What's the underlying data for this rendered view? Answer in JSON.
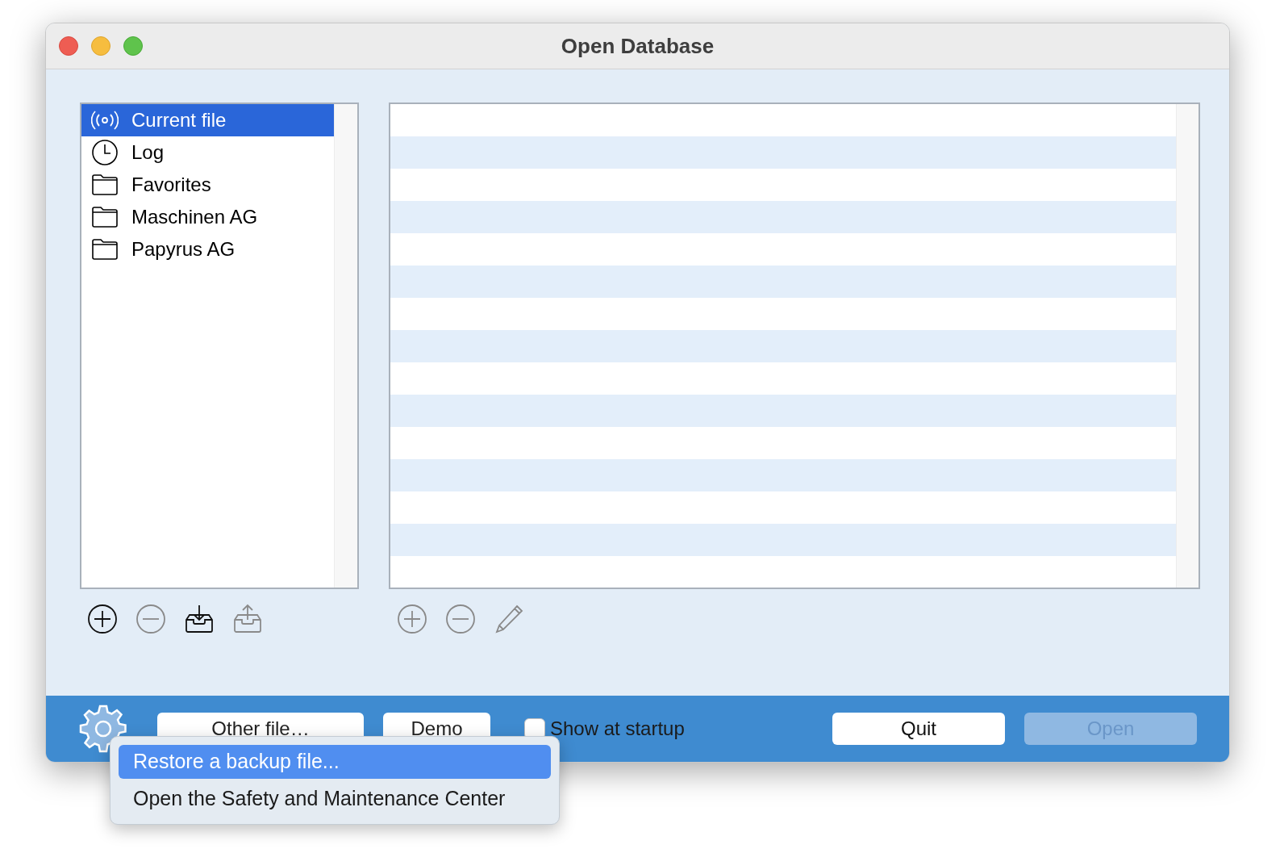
{
  "window": {
    "title": "Open Database"
  },
  "sidebar": {
    "items": [
      {
        "kind": "broadcast",
        "label": "Current file",
        "selected": true
      },
      {
        "kind": "clock",
        "label": "Log",
        "selected": false
      },
      {
        "kind": "folder",
        "label": "Favorites",
        "selected": false
      },
      {
        "kind": "folder",
        "label": "Maschinen AG",
        "selected": false
      },
      {
        "kind": "folder",
        "label": "Papyrus AG",
        "selected": false
      }
    ]
  },
  "sidebar_toolbar": [
    {
      "kind": "add",
      "disabled": false
    },
    {
      "kind": "remove",
      "disabled": true
    },
    {
      "kind": "import",
      "disabled": false
    },
    {
      "kind": "export",
      "disabled": true
    }
  ],
  "list_toolbar": [
    {
      "kind": "add",
      "disabled": true
    },
    {
      "kind": "remove",
      "disabled": true
    },
    {
      "kind": "edit",
      "disabled": true
    }
  ],
  "bottom_bar": {
    "buttons": [
      {
        "label": "Other file…",
        "disabled": false
      },
      {
        "label": "Demo",
        "disabled": false
      }
    ],
    "show_at_startup": {
      "label": "Show at startup",
      "checked": false
    },
    "quit": {
      "label": "Quit",
      "disabled": false
    },
    "open": {
      "label": "Open",
      "disabled": true
    }
  },
  "menu": {
    "items": [
      {
        "label": "Restore a backup file...",
        "selected": true
      },
      {
        "label": "Open the Safety and Maintenance Center",
        "selected": false
      }
    ]
  }
}
